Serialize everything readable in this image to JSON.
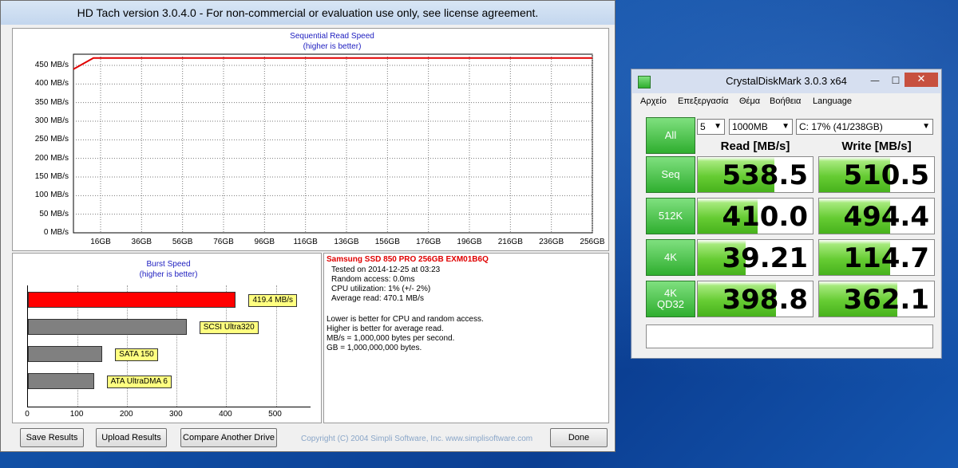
{
  "hdtach": {
    "title": "HD Tach version 3.0.4.0  - For non-commercial or evaluation use only, see license agreement.",
    "seq_chart": {
      "title1": "Sequential Read Speed",
      "title2": "(higher is better)",
      "y_labels": [
        "450 MB/s",
        "400 MB/s",
        "350 MB/s",
        "300 MB/s",
        "250 MB/s",
        "200 MB/s",
        "150 MB/s",
        "100 MB/s",
        "50 MB/s",
        "0 MB/s"
      ],
      "x_labels": [
        "16GB",
        "36GB",
        "56GB",
        "76GB",
        "96GB",
        "116GB",
        "136GB",
        "156GB",
        "176GB",
        "196GB",
        "216GB",
        "236GB",
        "256GB"
      ]
    },
    "burst_chart": {
      "title1": "Burst Speed",
      "title2": "(higher is better)",
      "x_labels": [
        "0",
        "100",
        "200",
        "300",
        "400",
        "500"
      ]
    },
    "info": {
      "drive": "Samsung SSD 850 PRO 256GB EXM01B6Q",
      "tested": "Tested on 2014-12-25 at 03:23",
      "random": "Random access: 0.0ms",
      "cpu": "CPU utilization: 1% (+/- 2%)",
      "avg": "Average read: 470.1 MB/s",
      "note1": "Lower is better for CPU and random access.",
      "note2": "Higher is better for average read.",
      "note3": "MB/s = 1,000,000 bytes per second.",
      "note4": "GB = 1,000,000,000 bytes."
    },
    "buttons": {
      "save": "Save Results",
      "upload": "Upload Results",
      "compare": "Compare Another Drive",
      "done": "Done"
    },
    "copyright": "Copyright (C) 2004 Simpli Software, Inc. www.simplisoftware.com"
  },
  "chart_data": [
    {
      "type": "line",
      "title": "Sequential Read Speed",
      "subtitle": "(higher is better)",
      "ylim": [
        0,
        480
      ],
      "y_ticks": [
        0,
        50,
        100,
        150,
        200,
        250,
        300,
        350,
        400,
        450
      ],
      "x_ticks": [
        "16GB",
        "36GB",
        "56GB",
        "76GB",
        "96GB",
        "116GB",
        "136GB",
        "156GB",
        "176GB",
        "196GB",
        "216GB",
        "236GB",
        "256GB"
      ],
      "series": [
        {
          "values": [
            440,
            470,
            470,
            470,
            470,
            470,
            470,
            470,
            470,
            470,
            470,
            470,
            470,
            470,
            470,
            470,
            470,
            470,
            470,
            470,
            470,
            470,
            470,
            470,
            470,
            470,
            470
          ]
        }
      ]
    },
    {
      "type": "bar",
      "title": "Burst Speed",
      "subtitle": "(higher is better)",
      "orientation": "horizontal",
      "xlim": [
        0,
        570
      ],
      "x_ticks": [
        0,
        100,
        200,
        300,
        400,
        500
      ],
      "categories": [
        "419.4 MB/s",
        "SCSI Ultra320",
        "SATA 150",
        "ATA UltraDMA 6"
      ],
      "values": [
        419.4,
        320,
        150,
        133
      ],
      "colors": [
        "#ff0000",
        "#808080",
        "#808080",
        "#808080"
      ]
    }
  ],
  "cdm": {
    "title": "CrystalDiskMark 3.0.3 x64",
    "menu": [
      "Αρχείο",
      "Επεξεργασία",
      "Θέμα",
      "Βοήθεια",
      "Language"
    ],
    "runs": "5",
    "size": "1000MB",
    "drive": "C: 17% (41/238GB)",
    "all_label": "All",
    "read_header": "Read [MB/s]",
    "write_header": "Write [MB/s]",
    "rows": [
      {
        "label": "Seq",
        "label2": "",
        "read": "538.5",
        "write": "510.5",
        "read_fill": 0.67,
        "write_fill": 0.62
      },
      {
        "label": "512K",
        "label2": "",
        "read": "410.0",
        "write": "494.4",
        "read_fill": 0.52,
        "write_fill": 0.62
      },
      {
        "label": "4K",
        "label2": "",
        "read": "39.21",
        "write": "114.7",
        "read_fill": 0.42,
        "write_fill": 0.62
      },
      {
        "label": "4K",
        "label2": "QD32",
        "read": "398.8",
        "write": "362.1",
        "read_fill": 0.68,
        "write_fill": 0.68
      }
    ],
    "comment": ""
  }
}
